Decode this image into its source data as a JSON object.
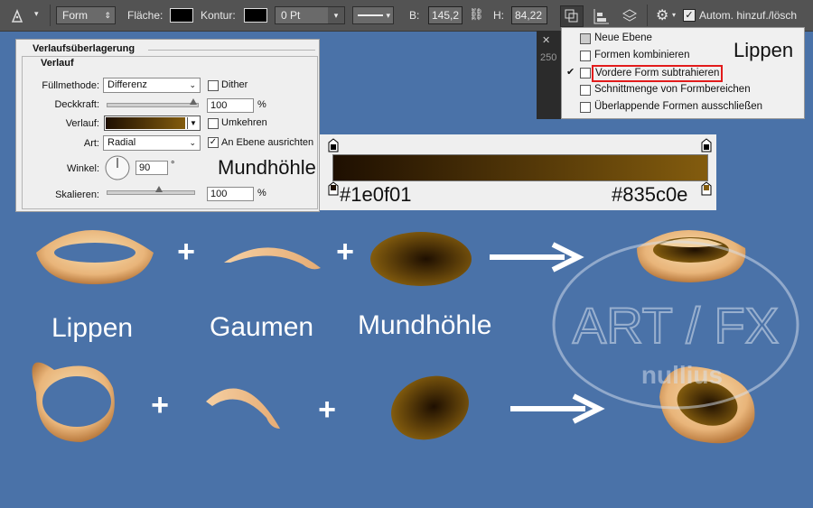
{
  "toolbar": {
    "mode_label": "Form",
    "fill_label": "Fläche:",
    "stroke_label": "Kontur:",
    "stroke_width": "0 Pt",
    "b_label": "B:",
    "b_value": "145,2",
    "h_label": "H:",
    "h_value": "84,22",
    "auto_label": "Autom. hinzuf./lösch"
  },
  "path_menu": {
    "items": [
      {
        "label": "Neue Ebene",
        "checked": false
      },
      {
        "label": "Formen kombinieren",
        "checked": false
      },
      {
        "label": "Vordere Form subtrahieren",
        "checked": true
      },
      {
        "label": "Schnittmenge von Formbereichen",
        "checked": false
      },
      {
        "label": "Überlappende Formen ausschließen",
        "checked": false
      }
    ],
    "side_number": "250"
  },
  "dialog": {
    "title": "Verlaufsüberlagerung",
    "group": "Verlauf",
    "blend_label": "Füllmethode:",
    "blend_value": "Differenz",
    "dither_label": "Dither",
    "opacity_label": "Deckkraft:",
    "opacity_value": "100",
    "opacity_unit": "%",
    "opacity_level": 1.0,
    "gradient_label": "Verlauf:",
    "reverse_label": "Umkehren",
    "style_label": "Art:",
    "style_value": "Radial",
    "align_label": "An Ebene ausrichten",
    "angle_label": "Winkel:",
    "angle_value": "90",
    "angle_unit": "°",
    "scale_label": "Skalieren:",
    "scale_value": "100",
    "scale_unit": "%",
    "scale_level": 0.6
  },
  "gradient_panel": {
    "title": "Mundhöhle",
    "color_start": "#1e0f01",
    "color_end": "#835c0e",
    "start_label": "#1e0f01",
    "end_label": "#835c0e"
  },
  "labels": {
    "lippen_top": "Lippen",
    "lippen": "Lippen",
    "gaumen": "Gaumen",
    "mundhoehle": "Mundhöhle",
    "plus": "+"
  },
  "colors": {
    "background": "#4a72a8",
    "lip_light": "#f3d2a0",
    "lip_dark": "#c98a4a",
    "highlight_box": "#e21b1b"
  },
  "watermark": {
    "line1": "ART / FX",
    "line2": "nullius"
  }
}
